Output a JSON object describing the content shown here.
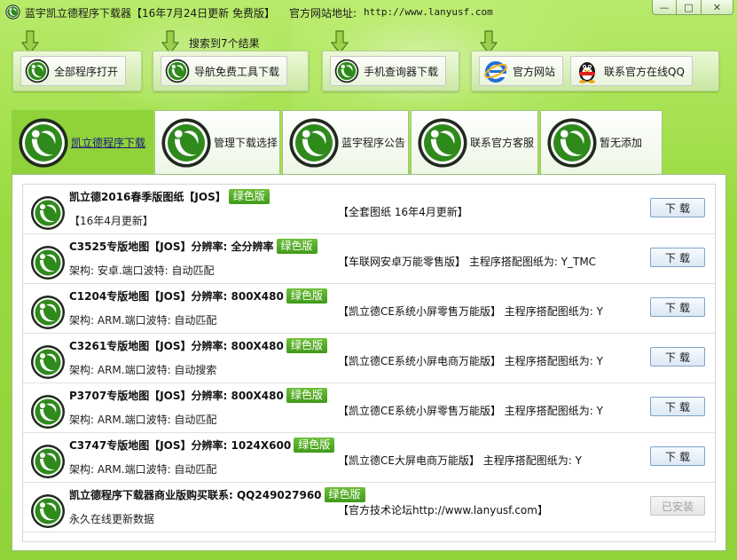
{
  "window": {
    "title": "蓝宇凯立德程序下载器【16年7月24日更新 免费版】",
    "site_label": "官方网站地址:",
    "site_url": "http://www.lanyusf.com",
    "controls": {
      "minimize": "—",
      "maximize": "□",
      "close": "✕"
    }
  },
  "toolbar": {
    "search_result": "搜索到7个结果",
    "buttons": [
      {
        "label": "全部程序打开",
        "icon": "kld-logo-icon"
      },
      {
        "label": "导航免费工具下载",
        "icon": "kld-logo-icon"
      },
      {
        "label": "手机查询器下载",
        "icon": "kld-logo-icon"
      },
      {
        "label": "官方网站",
        "icon": "ie-icon"
      },
      {
        "label": "联系官方在线QQ",
        "icon": "qq-penguin-icon"
      }
    ]
  },
  "tabs": [
    {
      "label": "凯立德程序下载",
      "active": true
    },
    {
      "label": "管理下载选择",
      "active": false
    },
    {
      "label": "蓝宇程序公告",
      "active": false
    },
    {
      "label": "联系官方客服",
      "active": false
    },
    {
      "label": "暂无添加",
      "active": false
    }
  ],
  "list": {
    "badge_label": "绿色版",
    "rows": [
      {
        "title": "凯立德2016春季版图纸【JOS】",
        "subtitle": "【16年4月更新】",
        "desc": "【全套图纸 16年4月更新】",
        "action": "下载",
        "installed": false
      },
      {
        "title": "C3525专版地图【JOS】分辨率: 全分辨率",
        "subtitle": "架构: 安卓.端口波特: 自动匹配",
        "desc": "【车联网安卓万能零售版】  主程序搭配图纸为: Y_TMC",
        "action": "下载",
        "installed": false
      },
      {
        "title": "C1204专版地图【JOS】分辨率: 800X480",
        "subtitle": "架构: ARM.端口波特: 自动匹配",
        "desc": "【凯立德CE系统小屏零售万能版】  主程序搭配图纸为: Y",
        "action": "下载",
        "installed": false
      },
      {
        "title": "C3261专版地图【JOS】分辨率: 800X480",
        "subtitle": "架构: ARM.端口波特: 自动搜索",
        "desc": "【凯立德CE系统小屏电商万能版】  主程序搭配图纸为: Y",
        "action": "下载",
        "installed": false
      },
      {
        "title": "P3707专版地图【JOS】分辨率: 800X480",
        "subtitle": "架构: ARM.端口波特: 自动匹配",
        "desc": "【凯立德CE系统小屏零售万能版】  主程序搭配图纸为: Y",
        "action": "下载",
        "installed": false
      },
      {
        "title": "C3747专版地图【JOS】分辨率: 1024X600",
        "subtitle": "架构: ARM.端口波特: 自动匹配",
        "desc": "【凯立德CE大屏电商万能版】  主程序搭配图纸为: Y",
        "action": "下载",
        "installed": false
      },
      {
        "title": "凯立德程序下载器商业版购买联系: QQ249027960",
        "subtitle": "永久在线更新数据",
        "desc": "【官方技术论坛http://www.lanyusf.com】",
        "action": "已安装",
        "installed": true
      }
    ]
  },
  "colors": {
    "accent_green": "#8fd23a",
    "badge_green": "#3f9a1a",
    "logo_green": "#2f8a1c"
  }
}
